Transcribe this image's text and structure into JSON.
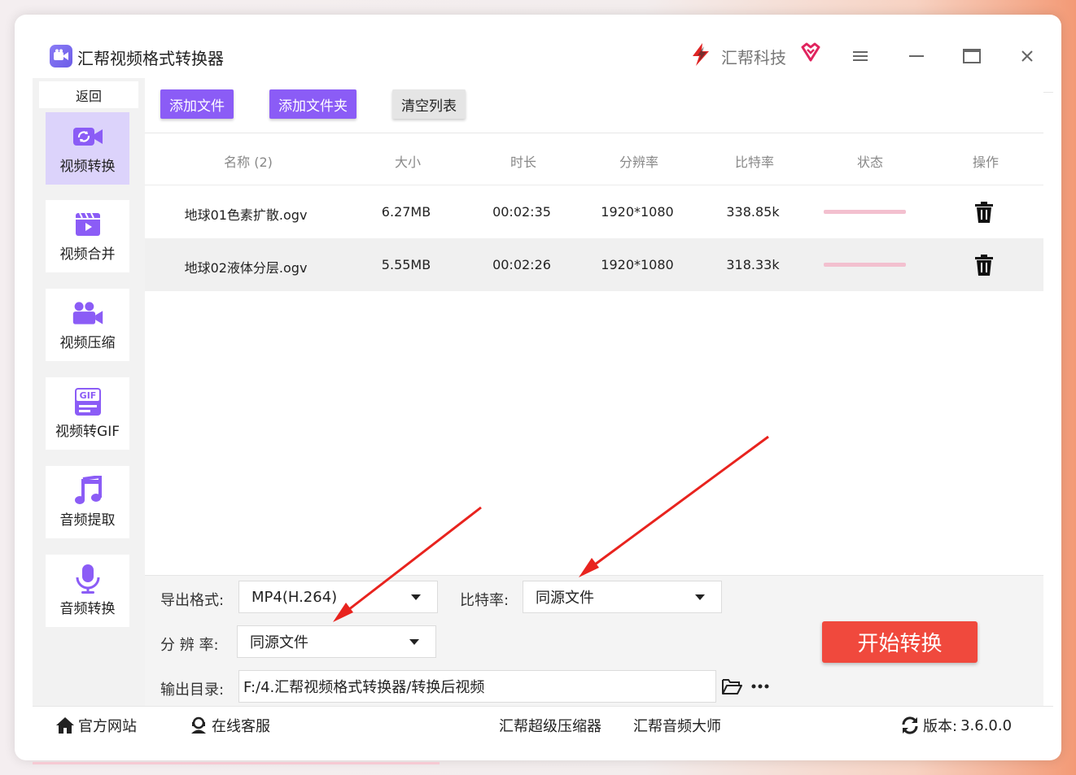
{
  "app": {
    "title": "汇帮视频格式转换器",
    "brand": "汇帮科技",
    "accent": "#8b5cf6",
    "start_color": "#f0493d"
  },
  "sidebar": {
    "back_label": "返回",
    "items": [
      {
        "label": "视频转换",
        "icon": "video-convert-icon",
        "active": true
      },
      {
        "label": "视频合并",
        "icon": "video-merge-icon",
        "active": false
      },
      {
        "label": "视频压缩",
        "icon": "video-compress-icon",
        "active": false
      },
      {
        "label": "视频转GIF",
        "icon": "gif-icon",
        "active": false
      },
      {
        "label": "音频提取",
        "icon": "music-note-icon",
        "active": false
      },
      {
        "label": "音频转换",
        "icon": "microphone-icon",
        "active": false
      }
    ]
  },
  "toolbar": {
    "add_file": "添加文件",
    "add_folder": "添加文件夹",
    "clear_list": "清空列表"
  },
  "table": {
    "headers": {
      "name": "名称 (2)",
      "size": "大小",
      "duration": "时长",
      "resolution": "分辨率",
      "bitrate": "比特率",
      "status": "状态",
      "action": "操作"
    },
    "rows": [
      {
        "name": "地球01色素扩散.ogv",
        "size": "6.27MB",
        "duration": "00:02:35",
        "resolution": "1920*1080",
        "bitrate": "338.85k",
        "progress": 0
      },
      {
        "name": "地球02液体分层.ogv",
        "size": "5.55MB",
        "duration": "00:02:26",
        "resolution": "1920*1080",
        "bitrate": "318.33k",
        "progress": 0
      }
    ]
  },
  "settings": {
    "format_label": "导出格式:",
    "format_value": "MP4(H.264)",
    "bitrate_label": "比特率:",
    "bitrate_value": "同源文件",
    "resolution_label": "分 辨 率:",
    "resolution_value": "同源文件",
    "output_label": "输出目录:",
    "output_value": "F:/4.汇帮视频格式转换器/转换后视频",
    "start_label": "开始转换"
  },
  "footer": {
    "website": "官方网站",
    "support": "在线客服",
    "link1": "汇帮超级压缩器",
    "link2": "汇帮音频大师",
    "version_label": "版本:",
    "version": "3.6.0.0"
  }
}
